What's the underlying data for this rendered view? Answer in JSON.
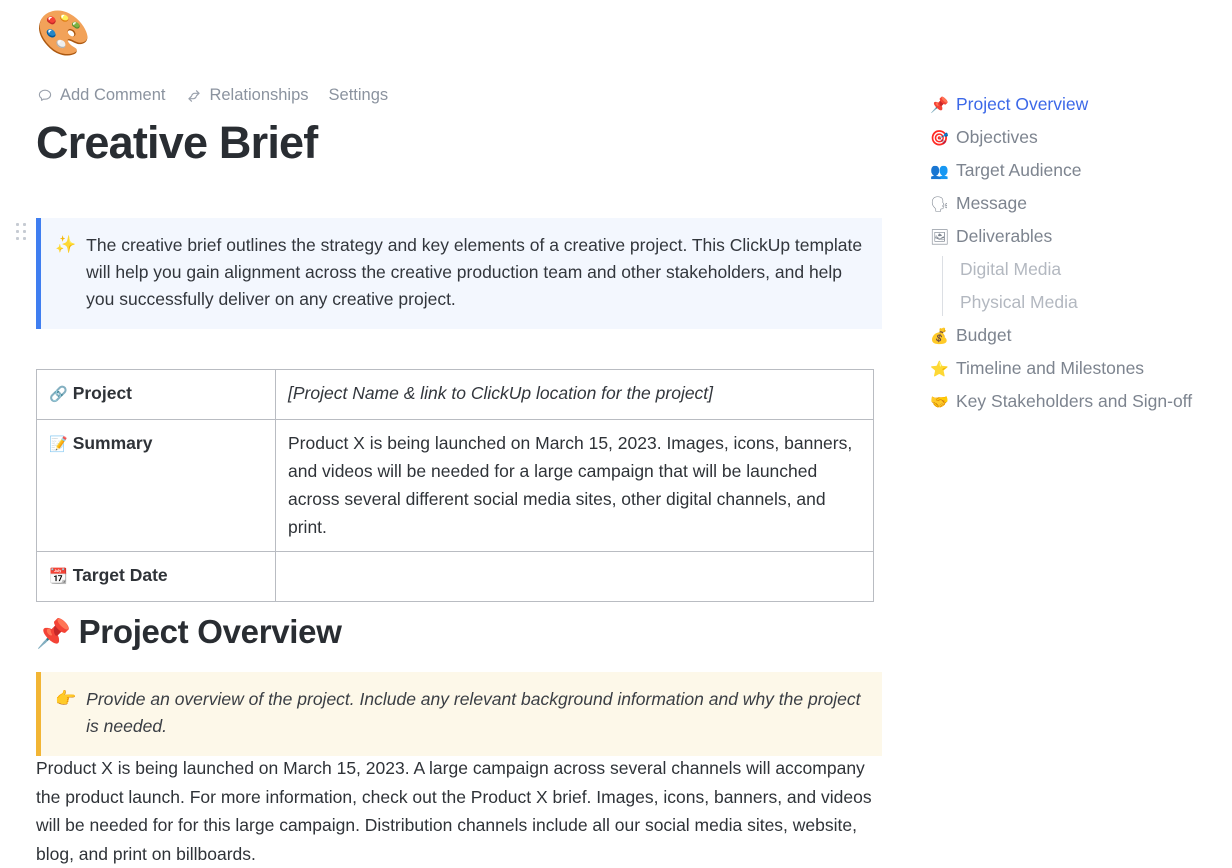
{
  "document": {
    "icon": "🎨",
    "icon_name": "artist-palette-emoji",
    "title": "Creative Brief"
  },
  "toolbar": {
    "add_comment": "Add Comment",
    "relationships": "Relationships",
    "settings": "Settings"
  },
  "intro_callout": {
    "emoji": "✨",
    "text": "The creative brief outlines the strategy and key elements of a creative project. This ClickUp template will help you gain alignment across the creative production team and other stakeholders, and help you successfully deliver on any creative project."
  },
  "brief_table": {
    "rows": [
      {
        "emoji": "🔗",
        "label": "Project",
        "value": "[Project Name & link to ClickUp location for the project]",
        "value_style": "placeholder"
      },
      {
        "emoji": "📝",
        "label": "Summary",
        "value": "Product X is being launched on March 15, 2023. Images, icons, banners, and videos will be needed for a large campaign that will be launched across several different social media sites, other digital channels, and print.",
        "value_style": "normal"
      },
      {
        "emoji": "📆",
        "label": "Target Date",
        "value": "",
        "value_style": "normal"
      }
    ]
  },
  "project_overview": {
    "heading_emoji": "📌",
    "heading": "Project Overview",
    "hint_callout": {
      "emoji": "👉",
      "text": "Provide an overview of the project. Include any relevant background information and why the project is needed."
    },
    "body": "Product X is being launched on March 15, 2023. A large campaign across several channels will accompany the product launch. For more information, check out the Product X brief. Images, icons, banners, and videos will be needed for for this large campaign. Distribution channels include all our social media sites, website, blog, and print on billboards."
  },
  "outline": {
    "items": [
      {
        "emoji": "📌",
        "label": "Project Overview",
        "active": true
      },
      {
        "emoji": "🎯",
        "label": "Objectives",
        "active": false
      },
      {
        "emoji": "👥",
        "label": "Target Audience",
        "active": false
      },
      {
        "emoji": "🗣",
        "label": "Message",
        "active": false
      },
      {
        "emoji": "🖼",
        "label": "Deliverables",
        "active": false
      }
    ],
    "sub_items": [
      {
        "label": "Digital Media"
      },
      {
        "label": "Physical Media"
      }
    ],
    "items_after": [
      {
        "emoji": "💰",
        "label": "Budget",
        "active": false
      },
      {
        "emoji": "⭐",
        "label": "Timeline and Milestones",
        "active": false
      },
      {
        "emoji": "🤝",
        "label": "Key Stakeholders and Sign-off",
        "active": false
      }
    ]
  },
  "colors": {
    "accent_blue": "#3c68e8",
    "callout_blue_border": "#3f7ef0",
    "callout_blue_bg": "#f3f7fe",
    "callout_yellow_border": "#f2b534",
    "callout_yellow_bg": "#fdf8e9",
    "text_primary": "#2f3338",
    "text_muted": "#7d848f"
  }
}
